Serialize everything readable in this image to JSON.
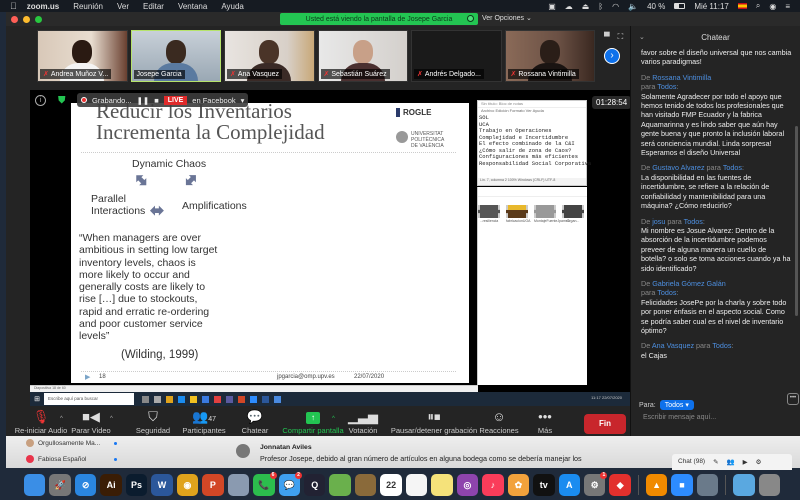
{
  "menubar": {
    "app": "zoom.us",
    "items": [
      "Reunión",
      "Ver",
      "Editar",
      "Ventana",
      "Ayuda"
    ],
    "battery": "40 %",
    "clock": "Mié 11:17"
  },
  "zoom": {
    "share_banner": "Usted está viendo la pantalla de Josepe Garcia",
    "view_options": "Ver Opciones ⌄",
    "participants": [
      {
        "name": "Andrea Muñoz V..."
      },
      {
        "name": "Josepe Garcia",
        "active": true
      },
      {
        "name": "Ana Vasquez"
      },
      {
        "name": "Sebastián Suárez"
      },
      {
        "name": "Andrés Delgado..."
      },
      {
        "name": "Rossana Vintimilla"
      }
    ],
    "recording": "Grabando...",
    "live_label": "LIVE",
    "live_target": "en Facebook",
    "timer": "01:28:54"
  },
  "slide": {
    "title_line1": "Reducir los Inventarios",
    "title_line2": "Incrementa la Complejidad",
    "logo_rogle": "ROGLE",
    "logo_upv": [
      "UNIVERSITAT",
      "POLITÈCNICA",
      "DE VALÈNCIA"
    ],
    "dynamic_chaos": "Dynamic Chaos",
    "parallel": "Parallel",
    "interactions": "Interactions",
    "amplifications": "Amplifications",
    "quote": [
      "“When managers are over",
      "ambitious in setting low target",
      "inventory levels, chaos is",
      "more likely to occur and",
      "generally costs are likely to",
      "rise […] due to stockouts,",
      "rapid and erratic re-ordering",
      "and poor customer service",
      "levels”"
    ],
    "citation": "(Wilding, 1999)",
    "page_number": "18",
    "email": "jpgarcia@omp.upv.es",
    "date": "22/07/2020",
    "ppt_status": "Diapositiva 18 de 60"
  },
  "notepad": {
    "title": "Sin título: Bloc de notas",
    "menu": "Archivo  Edición  Formato  Ver  Ayuda",
    "lines": [
      "SOL",
      "UCA",
      "Trabajo en Operaciones",
      "Complejidad e Incertidumbre",
      "El efecto combinado de la C&I",
      "¿Cómo salir de zona de Caos?",
      "Configuraciones más eficientes",
      "Responsabilidad Social Corporativa"
    ],
    "status": "Lín. 7, columna 2   100%   Windows (CRLF)   UTF-8"
  },
  "explorer": {
    "files": [
      "...resiliencia",
      "fabricacionUOA",
      "MontajeFuenteJpame1",
      "Organ..."
    ]
  },
  "windows_taskbar": {
    "search_placeholder": "Escribe aquí para buscar",
    "tray_time": "11:17",
    "tray_date": "22/07/2020"
  },
  "toolbar": {
    "items": [
      {
        "label": "Re-iniciar Audio",
        "icon": "mic-muted-icon"
      },
      {
        "label": "Parar Video",
        "icon": "video-icon"
      },
      {
        "label": "Seguridad",
        "icon": "shield-icon"
      },
      {
        "label": "Participantes",
        "icon": "participants-icon",
        "count": "47"
      },
      {
        "label": "Chatear",
        "icon": "chat-icon"
      },
      {
        "label": "Compartir pantalla",
        "icon": "share-screen-icon"
      },
      {
        "label": "Votación",
        "icon": "poll-icon"
      },
      {
        "label": "Pausar/detener grabación",
        "icon": "pause-stop-icon"
      },
      {
        "label": "Reacciones",
        "icon": "reactions-icon"
      },
      {
        "label": "Más",
        "icon": "more-icon"
      }
    ],
    "end_label": "Fin"
  },
  "chat": {
    "title": "Chatear",
    "messages": [
      {
        "from": "",
        "to": "",
        "text": "favor sobre el diseño universal que nos cambia varios paradigmas!"
      },
      {
        "from": "Rossana Vintimilla",
        "to": "Todos",
        "text": "Solamente Agradecer por todo el apoyo que hemos tenido de todos los profesionales que han visitado FMP Ecuador y la fabrica Aquamarinna y es lindo saber que aún hay gente buena y que pronto la inclusión laboral será conciencia mundial. Linda sorpresa! Esperamos el diseño Universal"
      },
      {
        "from": "Gustavo Alvarez",
        "to": "Todos",
        "text": "La disponibilidad en las fuentes de incertidumbre, se refiere a la relación de confiabilidad y mantenibilidad para una máquina? ¿Cómo reducirlo?"
      },
      {
        "from": "josu",
        "to": "Todos",
        "text": "Mi nombre es Josue Alvarez: Dentro de la absorción de la incertidumbre podemos preveer de alguna manera un cuello de botella? o solo se toma acciones cuando ya ha sido identificado?"
      },
      {
        "from": "Gabriela Gómez Galán",
        "to": "Todos",
        "text": "Felicidades JosePe por la charla y sobre todo por  poner énfasis en el aspecto social. Como se podría saber cual es el nivel de inventario óptimo?"
      },
      {
        "from": "Ana Vasquez",
        "to": "Todos",
        "text": "el Cajas"
      }
    ],
    "de_label": "De",
    "para_label": "para",
    "to_label": "Para:",
    "to_value": "Todos ▾",
    "input_placeholder": "Escribir mensaje aquí..."
  },
  "facebook": {
    "pages": [
      "Orgullosamente Ma...",
      "Fabiosa Español"
    ],
    "comment_author": "Jonnatan Aviles",
    "comment_text": "Profesor Josepe, debido al gran número de artículos en alguna bodega como se debería manejar los",
    "chat_label": "Chat (98)"
  },
  "dock": {
    "apps": [
      {
        "name": "finder-icon",
        "color": "#3a8ee6",
        "label": ""
      },
      {
        "name": "launchpad-icon",
        "color": "#777",
        "label": "🚀"
      },
      {
        "name": "safari-icon",
        "color": "#2a86e0",
        "label": "⊘"
      },
      {
        "name": "illustrator-icon",
        "color": "#3a1d05",
        "label": "Ai"
      },
      {
        "name": "photoshop-icon",
        "color": "#0b1c2e",
        "label": "Ps"
      },
      {
        "name": "word-icon",
        "color": "#2b579a",
        "label": "W"
      },
      {
        "name": "chrome-icon",
        "color": "#e0a31c",
        "label": "◉"
      },
      {
        "name": "powerpoint-icon",
        "color": "#d24726",
        "label": "P"
      },
      {
        "name": "preview-icon",
        "color": "#8a9ab0",
        "label": ""
      },
      {
        "name": "facetime-icon",
        "color": "#2cbd4d",
        "label": "📞",
        "badge": "6"
      },
      {
        "name": "messages-icon",
        "color": "#3fa0f0",
        "label": "💬",
        "badge": "2"
      },
      {
        "name": "quicktime-icon",
        "color": "#223",
        "label": "Q"
      },
      {
        "name": "maps-icon",
        "color": "#6ab04c",
        "label": ""
      },
      {
        "name": "notebook-icon",
        "color": "#8a6a3a",
        "label": ""
      },
      {
        "name": "calendar-icon",
        "color": "#fff",
        "label": "22"
      },
      {
        "name": "reminders-icon",
        "color": "#f5f5f5",
        "label": ""
      },
      {
        "name": "notes-icon",
        "color": "#f5e27a",
        "label": ""
      },
      {
        "name": "podcasts-icon",
        "color": "#8e44ad",
        "label": "◎"
      },
      {
        "name": "music-icon",
        "color": "#fa3c5a",
        "label": "♪"
      },
      {
        "name": "photos-icon",
        "color": "#f2a23c",
        "label": "✿"
      },
      {
        "name": "appletv-icon",
        "color": "#111",
        "label": "tv"
      },
      {
        "name": "appstore-icon",
        "color": "#1a8cf0",
        "label": "A"
      },
      {
        "name": "system-preferences-icon",
        "color": "#777",
        "label": "⚙",
        "badge": "1"
      },
      {
        "name": "anydesk-icon",
        "color": "#e2302d",
        "label": "◆"
      },
      {
        "name": "vlc-icon",
        "color": "#f08a00",
        "label": "▲"
      },
      {
        "name": "zoom-icon",
        "color": "#2d8cff",
        "label": "■"
      },
      {
        "name": "image-capture-icon",
        "color": "#6a7a8a",
        "label": ""
      },
      {
        "name": "folder-icon",
        "color": "#5aa8e0",
        "label": ""
      },
      {
        "name": "trash-icon",
        "color": "#888",
        "label": ""
      }
    ]
  }
}
